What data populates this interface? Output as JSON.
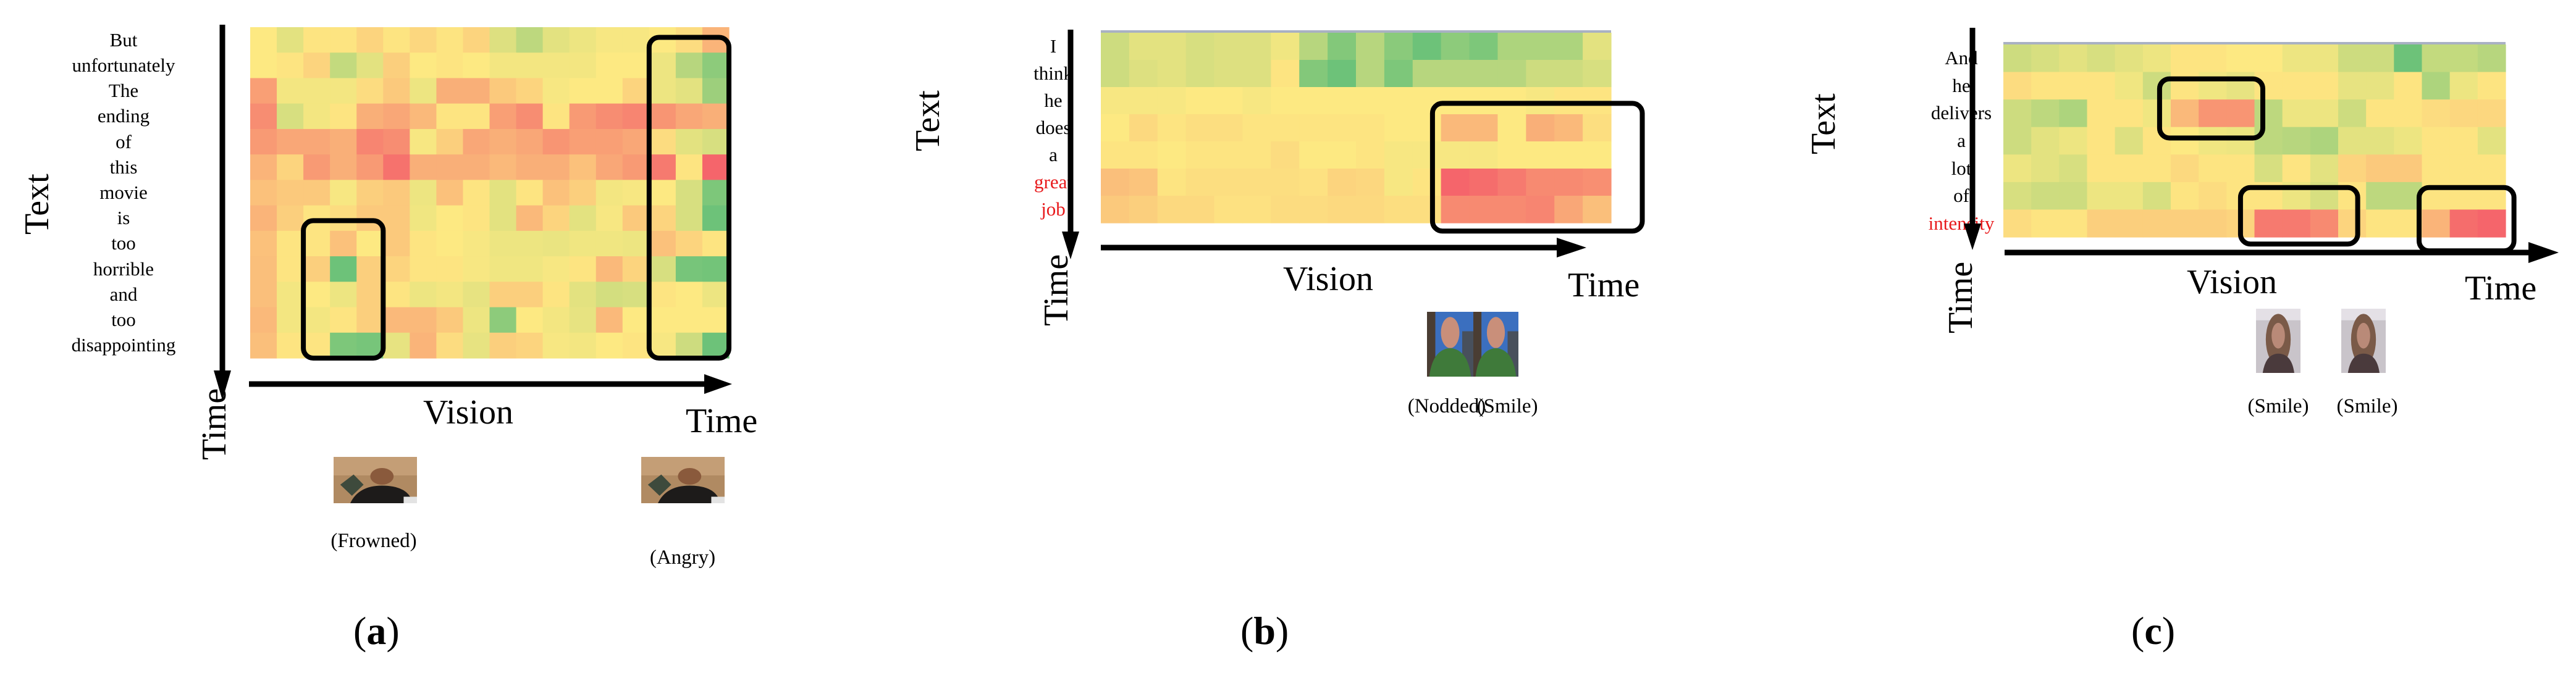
{
  "figure": {
    "colors": {
      "low": "#5dbe78",
      "mid": "#fde982",
      "high": "#f5656b",
      "highlight_text": "#e8191b",
      "box": "#000000"
    }
  },
  "chart_data": [
    {
      "type": "heatmap",
      "panel_label": "a",
      "ylabel": "Text",
      "xlabel": "Vision",
      "y_axis_arrow_label": "Time",
      "x_axis_arrow_label": "Time",
      "words": [
        "But",
        "unfortunately",
        "The",
        "ending",
        "of",
        "this",
        "movie",
        "is",
        "too",
        "horrible",
        "and",
        "too",
        "disappointing"
      ],
      "highlighted_words": [],
      "n_columns": 18,
      "value_scale": "0 = green (low), 0.5 = yellow, 1 = red (high)",
      "values": [
        [
          0.5,
          0.42,
          0.52,
          0.52,
          0.58,
          0.52,
          0.57,
          0.52,
          0.58,
          0.4,
          0.3,
          0.42,
          0.45,
          0.48,
          0.48,
          0.5,
          0.55,
          0.7
        ],
        [
          0.5,
          0.52,
          0.58,
          0.32,
          0.42,
          0.6,
          0.5,
          0.52,
          0.5,
          0.47,
          0.47,
          0.47,
          0.47,
          0.5,
          0.5,
          0.45,
          0.28,
          0.15
        ],
        [
          0.78,
          0.47,
          0.47,
          0.47,
          0.55,
          0.62,
          0.45,
          0.72,
          0.72,
          0.62,
          0.58,
          0.48,
          0.5,
          0.5,
          0.58,
          0.45,
          0.42,
          0.2
        ],
        [
          0.85,
          0.38,
          0.47,
          0.52,
          0.72,
          0.75,
          0.68,
          0.52,
          0.52,
          0.78,
          0.85,
          0.52,
          0.8,
          0.85,
          0.88,
          0.82,
          0.75,
          0.72
        ],
        [
          0.8,
          0.75,
          0.75,
          0.72,
          0.88,
          0.85,
          0.48,
          0.6,
          0.75,
          0.72,
          0.75,
          0.82,
          0.78,
          0.78,
          0.75,
          0.55,
          0.42,
          0.38
        ],
        [
          0.7,
          0.58,
          0.8,
          0.72,
          0.8,
          0.95,
          0.72,
          0.72,
          0.72,
          0.68,
          0.72,
          0.72,
          0.65,
          0.75,
          0.8,
          0.92,
          0.52,
          1.0
        ],
        [
          0.65,
          0.62,
          0.62,
          0.48,
          0.6,
          0.62,
          0.45,
          0.65,
          0.52,
          0.42,
          0.52,
          0.65,
          0.6,
          0.47,
          0.48,
          0.5,
          0.38,
          0.1
        ],
        [
          0.7,
          0.6,
          0.52,
          0.55,
          0.62,
          0.62,
          0.46,
          0.5,
          0.52,
          0.42,
          0.68,
          0.58,
          0.42,
          0.48,
          0.62,
          0.58,
          0.38,
          0.05
        ],
        [
          0.65,
          0.52,
          0.52,
          0.65,
          0.5,
          0.62,
          0.52,
          0.5,
          0.48,
          0.45,
          0.45,
          0.44,
          0.46,
          0.46,
          0.45,
          0.65,
          0.58,
          0.52
        ],
        [
          0.66,
          0.52,
          0.6,
          0.05,
          0.6,
          0.58,
          0.52,
          0.52,
          0.48,
          0.46,
          0.46,
          0.48,
          0.52,
          0.68,
          0.58,
          0.38,
          0.08,
          0.07
        ],
        [
          0.66,
          0.47,
          0.5,
          0.45,
          0.6,
          0.52,
          0.45,
          0.47,
          0.43,
          0.6,
          0.6,
          0.52,
          0.42,
          0.37,
          0.38,
          0.52,
          0.5,
          0.45
        ],
        [
          0.68,
          0.47,
          0.47,
          0.52,
          0.6,
          0.68,
          0.68,
          0.62,
          0.45,
          0.15,
          0.5,
          0.47,
          0.43,
          0.68,
          0.5,
          0.5,
          0.5,
          0.5
        ],
        [
          0.66,
          0.52,
          0.52,
          0.1,
          0.08,
          0.43,
          0.7,
          0.55,
          0.43,
          0.6,
          0.58,
          0.48,
          0.47,
          0.5,
          0.52,
          0.48,
          0.35,
          0.05
        ]
      ],
      "highlight_boxes": [
        {
          "rows": [
            7.6,
            13
          ],
          "cols": [
            2,
            5
          ]
        },
        {
          "rows": [
            0.4,
            13
          ],
          "cols": [
            15,
            18
          ]
        }
      ],
      "frames": [
        {
          "caption": "(Frowned)",
          "scene": "man-holding-object"
        },
        {
          "caption": "(Angry)",
          "scene": "man-holding-object"
        }
      ]
    },
    {
      "type": "heatmap",
      "panel_label": "b",
      "ylabel": "Text",
      "xlabel": "Vision",
      "y_axis_arrow_label": "Time",
      "x_axis_arrow_label": "Time",
      "words": [
        "I",
        "think",
        "he",
        "does",
        "a",
        "great",
        "job"
      ],
      "highlighted_words": [
        "great",
        "job"
      ],
      "n_columns": 18,
      "value_scale": "0 = green (low), 0.5 = yellow, 1 = red (high)",
      "values": [
        [
          0.35,
          0.42,
          0.42,
          0.38,
          0.4,
          0.4,
          0.46,
          0.28,
          0.12,
          0.28,
          0.14,
          0.05,
          0.15,
          0.1,
          0.25,
          0.25,
          0.25,
          0.42
        ],
        [
          0.35,
          0.4,
          0.42,
          0.38,
          0.4,
          0.4,
          0.52,
          0.12,
          0.05,
          0.28,
          0.1,
          0.28,
          0.28,
          0.28,
          0.28,
          0.35,
          0.35,
          0.38
        ],
        [
          0.48,
          0.48,
          0.48,
          0.5,
          0.5,
          0.48,
          0.5,
          0.5,
          0.5,
          0.5,
          0.5,
          0.5,
          0.5,
          0.5,
          0.5,
          0.48,
          0.52,
          0.52
        ],
        [
          0.5,
          0.56,
          0.52,
          0.54,
          0.54,
          0.52,
          0.52,
          0.52,
          0.52,
          0.52,
          0.5,
          0.5,
          0.68,
          0.68,
          0.5,
          0.72,
          0.68,
          0.54
        ],
        [
          0.52,
          0.52,
          0.5,
          0.52,
          0.52,
          0.52,
          0.55,
          0.5,
          0.5,
          0.52,
          0.48,
          0.48,
          0.48,
          0.48,
          0.5,
          0.5,
          0.5,
          0.5
        ],
        [
          0.66,
          0.64,
          0.52,
          0.54,
          0.54,
          0.54,
          0.54,
          0.53,
          0.58,
          0.57,
          0.48,
          0.52,
          1.0,
          0.97,
          0.92,
          0.86,
          0.86,
          0.84
        ],
        [
          0.62,
          0.6,
          0.56,
          0.56,
          0.53,
          0.53,
          0.55,
          0.55,
          0.56,
          0.56,
          0.54,
          0.54,
          0.86,
          0.86,
          0.86,
          0.88,
          0.75,
          0.66
        ]
      ],
      "highlight_boxes": [
        {
          "rows": [
            2.6,
            7.3
          ],
          "cols": [
            11.7,
            19.1
          ]
        }
      ],
      "frames": [
        {
          "caption": "(Nodded)",
          "scene": "man-green-sweater"
        },
        {
          "caption": "(Smile)",
          "scene": "man-green-sweater"
        }
      ]
    },
    {
      "type": "heatmap",
      "panel_label": "c",
      "ylabel": "Text",
      "xlabel": "Vision",
      "y_axis_arrow_label": "Time",
      "x_axis_arrow_label": "Time",
      "words": [
        "And",
        "he",
        "delivers",
        "a",
        "lot",
        "of",
        "intensity"
      ],
      "highlighted_words": [
        "intensity"
      ],
      "n_columns": 18,
      "value_scale": "0 = green (low), 0.5 = yellow, 1 = red (high)",
      "values": [
        [
          0.35,
          0.38,
          0.42,
          0.38,
          0.42,
          0.45,
          0.52,
          0.52,
          0.5,
          0.5,
          0.45,
          0.45,
          0.35,
          0.35,
          0.05,
          0.32,
          0.32,
          0.28
        ],
        [
          0.55,
          0.52,
          0.52,
          0.52,
          0.46,
          0.35,
          0.52,
          0.46,
          0.43,
          0.52,
          0.52,
          0.52,
          0.43,
          0.43,
          0.52,
          0.25,
          0.45,
          0.52
        ],
        [
          0.35,
          0.3,
          0.25,
          0.52,
          0.52,
          0.46,
          0.68,
          0.82,
          0.82,
          0.3,
          0.45,
          0.45,
          0.35,
          0.52,
          0.52,
          0.55,
          0.57,
          0.57
        ],
        [
          0.35,
          0.42,
          0.45,
          0.52,
          0.4,
          0.52,
          0.5,
          0.46,
          0.45,
          0.3,
          0.28,
          0.25,
          0.42,
          0.42,
          0.45,
          0.52,
          0.52,
          0.42
        ],
        [
          0.45,
          0.42,
          0.38,
          0.52,
          0.52,
          0.52,
          0.56,
          0.52,
          0.52,
          0.38,
          0.52,
          0.42,
          0.58,
          0.62,
          0.62,
          0.52,
          0.52,
          0.52
        ],
        [
          0.38,
          0.35,
          0.35,
          0.45,
          0.45,
          0.38,
          0.52,
          0.55,
          0.52,
          0.52,
          0.45,
          0.38,
          0.52,
          0.3,
          0.3,
          0.52,
          0.52,
          0.52
        ],
        [
          0.55,
          0.52,
          0.52,
          0.6,
          0.6,
          0.6,
          0.6,
          0.6,
          0.58,
          0.92,
          0.92,
          0.86,
          0.58,
          0.52,
          0.52,
          0.7,
          0.97,
          1.0
        ]
      ],
      "highlight_boxes": [
        {
          "rows": [
            1.25,
            3.4
          ],
          "cols": [
            5.6,
            9.3
          ]
        },
        {
          "rows": [
            5.2,
            7.25
          ],
          "cols": [
            8.5,
            12.7
          ]
        },
        {
          "rows": [
            5.2,
            7.5
          ],
          "cols": [
            14.9,
            18.3
          ]
        }
      ],
      "frames": [
        {
          "caption": "(Smile)",
          "scene": "woman-long-hair"
        },
        {
          "caption": "(Smile)",
          "scene": "woman-long-hair"
        }
      ]
    }
  ]
}
